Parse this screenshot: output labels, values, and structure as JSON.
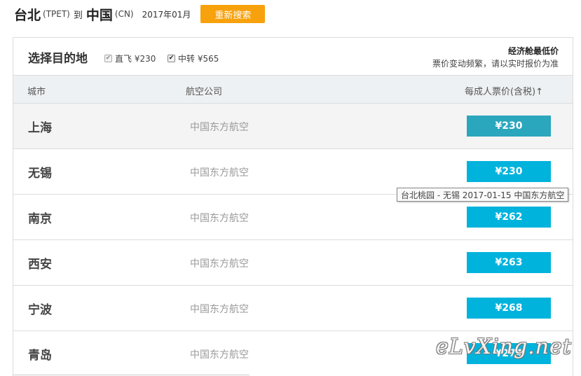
{
  "search": {
    "origin_city": "台北",
    "origin_code": "(TPET)",
    "to_word": "到",
    "dest_city": "中国",
    "dest_code": "(CN)",
    "month": "2017年01月",
    "research_label": "重新搜索",
    "research_color": "#f7a10c"
  },
  "panel": {
    "title": "选择目的地",
    "filters": [
      {
        "label": "直飞 ¥230",
        "checked": true,
        "disabled": true
      },
      {
        "label": "中转 ¥565",
        "checked": true,
        "disabled": false
      }
    ],
    "note_title": "经济舱最低价",
    "note_sub": "票价变动频繁，请以实时报价为准"
  },
  "columns": {
    "city": "城市",
    "airline": "航空公司",
    "price": "每成人票价(含税)↑"
  },
  "rows": [
    {
      "city": "上海",
      "airline": "中国东方航空",
      "price": "¥230",
      "highlighted": true
    },
    {
      "city": "无锡",
      "airline": "中国东方航空",
      "price": "¥230"
    },
    {
      "city": "南京",
      "airline": "中国东方航空",
      "price": "¥262"
    },
    {
      "city": "西安",
      "airline": "中国东方航空",
      "price": "¥263"
    },
    {
      "city": "宁波",
      "airline": "中国东方航空",
      "price": "¥268"
    },
    {
      "city": "青岛",
      "airline": "中国东方航空",
      "price": "¥274"
    }
  ],
  "tooltip": "台北桃园 - 无锡 2017-01-15 中国东方航空",
  "watermark": "eLvXing.net",
  "colors": {
    "price_button": "#00b3dc",
    "price_button_active": "#2aa6bd"
  }
}
